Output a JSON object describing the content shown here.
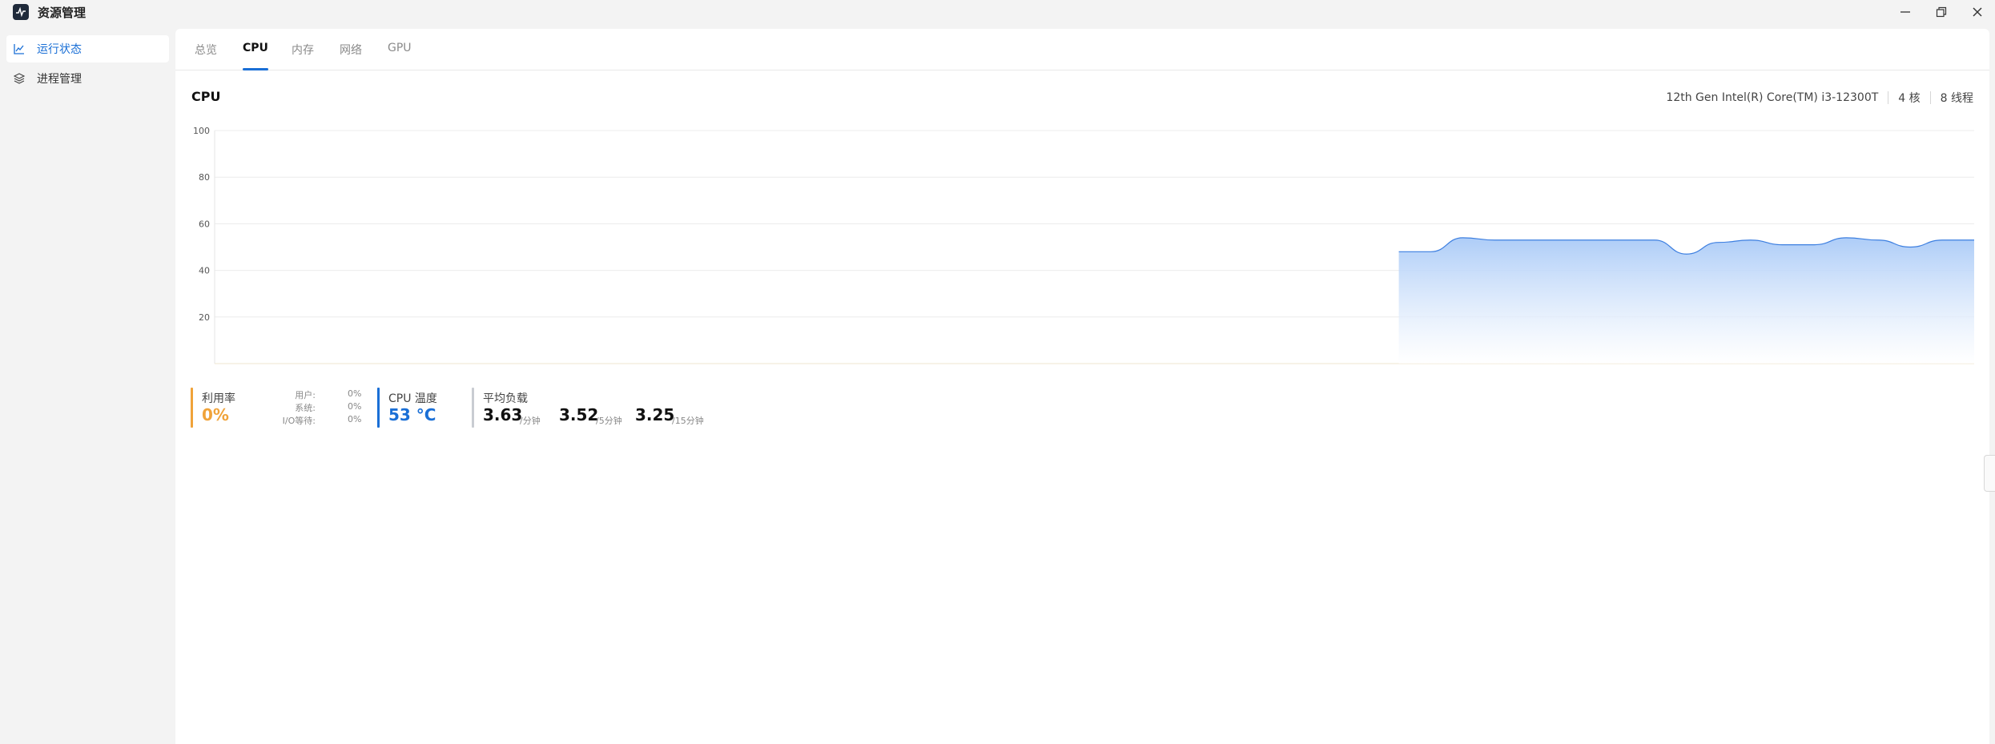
{
  "app": {
    "title": "资源管理"
  },
  "sidebar": {
    "items": [
      {
        "label": "运行状态",
        "icon": "line-chart-icon",
        "active": true
      },
      {
        "label": "进程管理",
        "icon": "layers-icon",
        "active": false
      }
    ]
  },
  "tabs": [
    {
      "label": "总览"
    },
    {
      "label": "CPU",
      "active": true
    },
    {
      "label": "内存"
    },
    {
      "label": "网络"
    },
    {
      "label": "GPU"
    }
  ],
  "cpu": {
    "title": "CPU",
    "model": "12th Gen Intel(R) Core(TM) i3-12300T",
    "cores": "4 核",
    "threads": "8 线程"
  },
  "chart_data": {
    "type": "area",
    "ylim": [
      0,
      100
    ],
    "yticks": [
      "100",
      "80",
      "60",
      "40",
      "20"
    ],
    "grid": true,
    "series": [
      {
        "color": "#3d7fe0",
        "fill_top": "#a9caf7",
        "values": [
          48,
          48,
          54,
          53,
          53,
          53,
          53,
          53,
          53,
          47,
          52,
          53,
          51,
          51,
          54,
          53,
          50,
          53,
          53
        ]
      }
    ],
    "x_start_fraction": 0.673
  },
  "stats": {
    "usage": {
      "label": "利用率",
      "value": "0%",
      "color": "#f0a33a"
    },
    "breakdown": [
      {
        "label": "用户:",
        "value": "0%"
      },
      {
        "label": "系统:",
        "value": "0%"
      },
      {
        "label": "I/O等待:",
        "value": "0%"
      }
    ],
    "temp": {
      "label": "CPU 温度",
      "value": "53 °C",
      "color": "#1a6fd6"
    },
    "load": {
      "label": "平均负载",
      "items": [
        {
          "value": "3.63",
          "unit": "/分钟"
        },
        {
          "value": "3.52",
          "unit": "/5分钟"
        },
        {
          "value": "3.25",
          "unit": "/15分钟"
        }
      ]
    }
  }
}
